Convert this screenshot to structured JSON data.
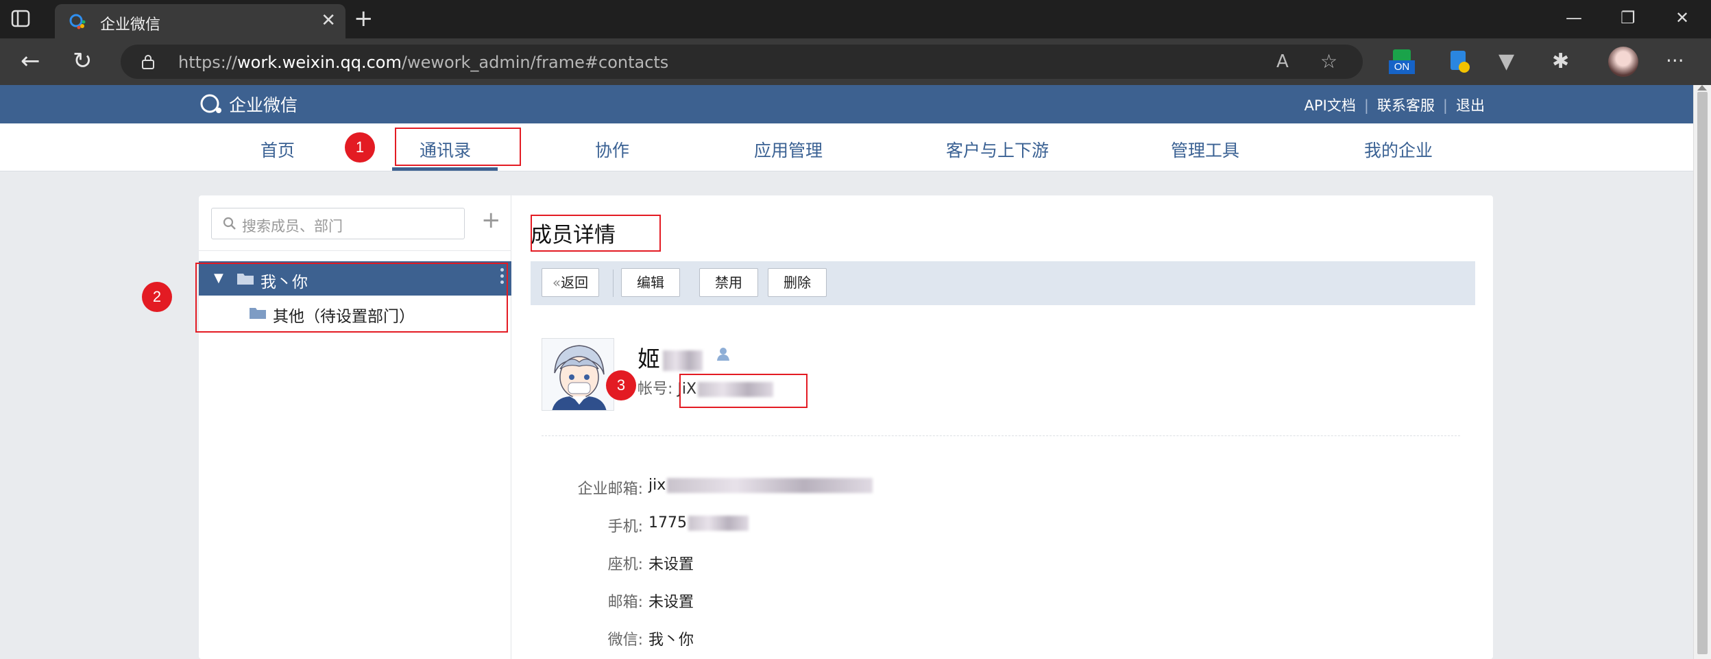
{
  "browser": {
    "tab_title": "企业微信",
    "url_prefix": "https://",
    "url_host": "work.weixin.qq.com",
    "url_path": "/wework_admin/frame#contacts"
  },
  "header": {
    "logo_text": "企业微信",
    "links": [
      "API文档",
      "联系客服",
      "退出"
    ]
  },
  "nav": {
    "items": [
      "首页",
      "通讯录",
      "协作",
      "应用管理",
      "客户与上下游",
      "管理工具",
      "我的企业"
    ],
    "active_index": 1
  },
  "sidebar": {
    "search_placeholder": "搜索成员、部门",
    "add_label": "+",
    "root_label": "我丶你",
    "child_label": "其他（待设置部门）"
  },
  "main": {
    "title": "成员详情",
    "buttons": [
      "返回",
      "编辑",
      "禁用",
      "删除"
    ],
    "member_name": "姬",
    "account_label": "帐号:",
    "account_value": "JiX",
    "fields": [
      {
        "label": "企业邮箱:",
        "value": "jix"
      },
      {
        "label": "手机:",
        "value": "1775"
      },
      {
        "label": "座机:",
        "value": "未设置"
      },
      {
        "label": "邮箱:",
        "value": "未设置"
      },
      {
        "label": "微信:",
        "value": "我丶你"
      }
    ]
  },
  "annotations": [
    "1",
    "2",
    "3"
  ],
  "colors": {
    "header_blue": "#3d6190",
    "annotation_red": "#e31b23",
    "toolbar_bg": "#dfe6ef"
  }
}
